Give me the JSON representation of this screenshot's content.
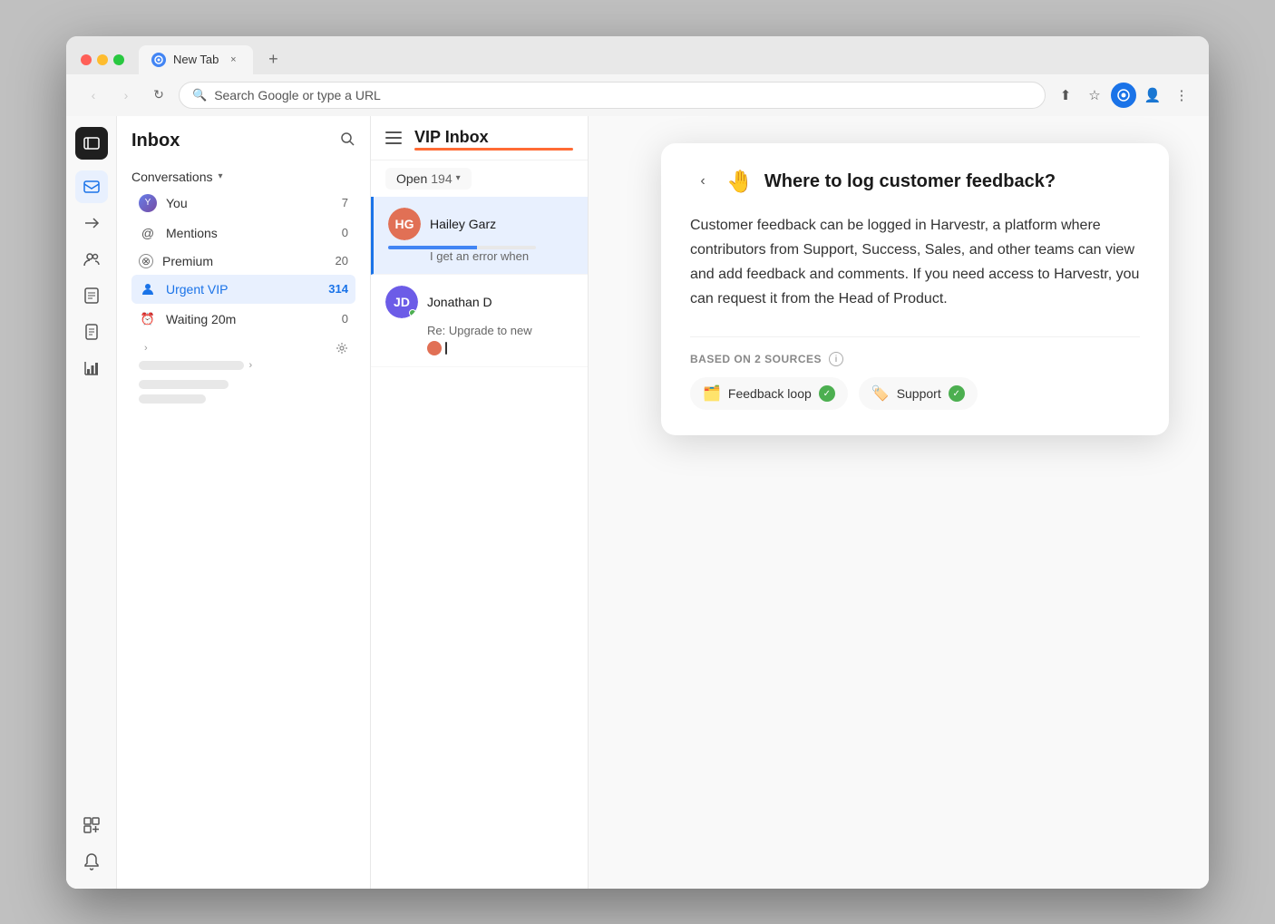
{
  "browser": {
    "tab_label": "New Tab",
    "new_tab_label": "+",
    "close_tab_label": "×",
    "address_placeholder": "Search Google or type a URL",
    "nav": {
      "back": "‹",
      "forward": "›",
      "refresh": "↻"
    }
  },
  "sidebar": {
    "logo_label": "≡",
    "icons": [
      {
        "name": "inbox-icon",
        "symbol": "✉",
        "active": true
      },
      {
        "name": "send-icon",
        "symbol": "✈",
        "active": false
      },
      {
        "name": "team-icon",
        "symbol": "👥",
        "active": false
      },
      {
        "name": "book-icon",
        "symbol": "📖",
        "active": false
      },
      {
        "name": "document-icon",
        "symbol": "📄",
        "active": false
      },
      {
        "name": "chart-icon",
        "symbol": "📊",
        "active": false
      },
      {
        "name": "compose-icon",
        "symbol": "⊞",
        "active": false
      },
      {
        "name": "bell-icon",
        "symbol": "🔔",
        "active": false
      }
    ]
  },
  "left_panel": {
    "title": "Inbox",
    "conversations_label": "Conversations",
    "nav_items": [
      {
        "id": "you",
        "label": "You",
        "count": "7",
        "icon": "person",
        "active": false
      },
      {
        "id": "mentions",
        "label": "Mentions",
        "count": "0",
        "icon": "at",
        "active": false
      },
      {
        "id": "premium",
        "label": "Premium",
        "count": "20",
        "icon": "circle",
        "active": false
      },
      {
        "id": "urgent-vip",
        "label": "Urgent VIP",
        "count": "314",
        "icon": "person-blue",
        "active": true
      },
      {
        "id": "waiting",
        "label": "Waiting 20m",
        "count": "0",
        "icon": "clock",
        "active": false
      }
    ]
  },
  "middle_panel": {
    "title": "VIP Inbox",
    "open_label": "Open",
    "open_count": "194",
    "conversations": [
      {
        "id": "hailey",
        "name": "Hailey Garz",
        "preview": "I get an error when",
        "avatar_color": "#e17055",
        "initials": "HG",
        "selected": true,
        "has_loading_bar": true
      },
      {
        "id": "jonathan",
        "name": "Jonathan D",
        "preview": "Re: Upgrade to new",
        "avatar_color": "#6c5ce7",
        "initials": "JD",
        "selected": false,
        "has_status": true,
        "has_typing": true
      }
    ]
  },
  "ai_panel": {
    "question": "Where to log customer feedback?",
    "emoji": "🤚",
    "answer": "Customer feedback can be logged in Harvestr, a platform where contributors from Support, Success, Sales, and other teams can view and add feedback and comments. If you need access to Harvestr, you can request it from the Head of Product.",
    "sources_label": "BASED ON 2 SOURCES",
    "sources": [
      {
        "id": "feedback-loop",
        "label": "Feedback loop",
        "icon": "🗂️"
      },
      {
        "id": "support",
        "label": "Support",
        "icon": "🏷️"
      }
    ]
  }
}
